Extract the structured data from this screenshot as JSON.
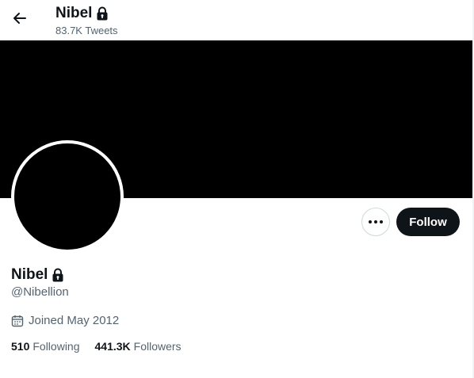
{
  "header": {
    "title": "Nibel",
    "tweet_count": "83.7K Tweets",
    "back_icon": "arrow-left-icon"
  },
  "profile": {
    "display_name": "Nibel",
    "handle": "@Nibellion",
    "joined": "Joined May 2012",
    "protected_icon": "lock-icon"
  },
  "actions": {
    "follow_label": "Follow",
    "more_icon": "more-horizontal-icon"
  },
  "stats": {
    "following_count": "510",
    "following_label": "Following",
    "followers_count": "441.3K",
    "followers_label": "Followers"
  },
  "colors": {
    "banner": "#000000",
    "avatar": "#000000",
    "text_primary": "#0f1419",
    "text_secondary": "#536471",
    "follow_button_bg": "#0f1419"
  }
}
